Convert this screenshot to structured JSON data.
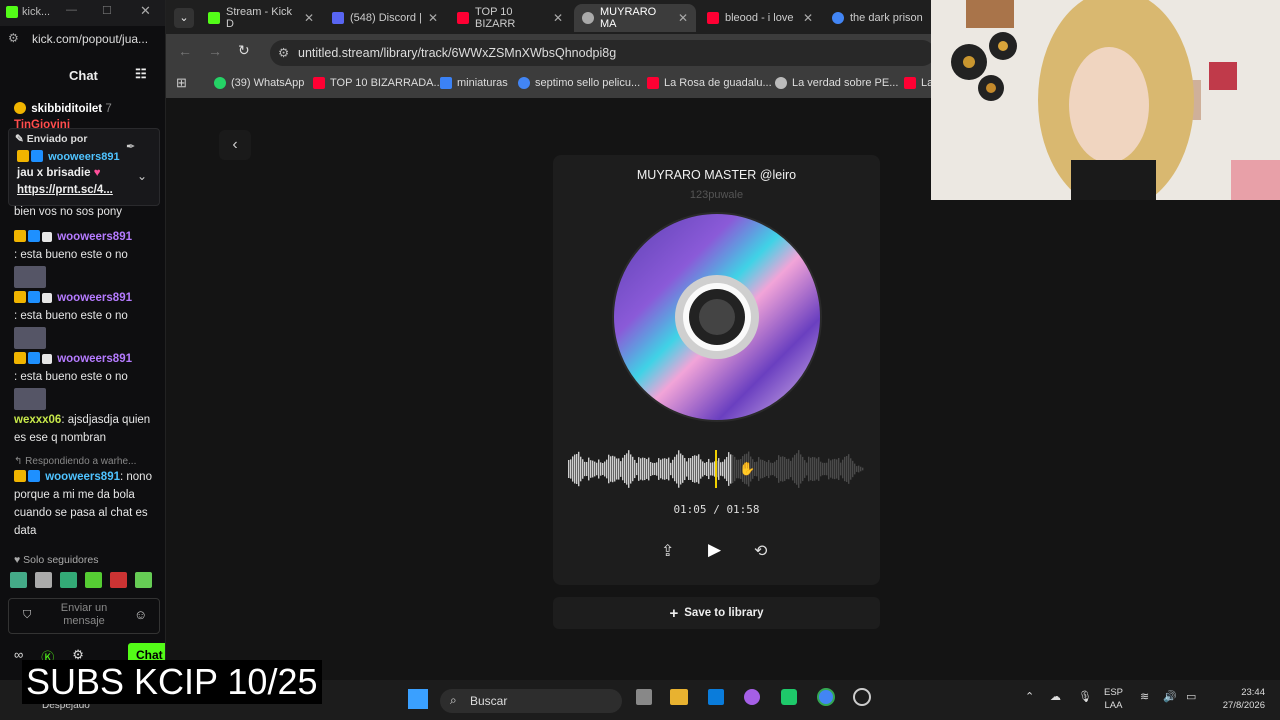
{
  "chat": {
    "window_title": "kick...",
    "url": "kick.com/popout/jua...",
    "header": "Chat",
    "top_user": "skibbiditoilet",
    "top_user_count": "7",
    "top_partial": "TinGiovini",
    "pinned_label": "Enviado por",
    "pinned_user": "wooweers891",
    "pinned_text": "jau x brisadie",
    "pinned_link": "https://prnt.sc/4...",
    "messages": [
      {
        "user": "",
        "text": "bien vos no sos pony"
      },
      {
        "user": "wooweers891",
        "text": ": esta bueno este o no"
      },
      {
        "user": "wooweers891",
        "text": ": esta bueno este o no"
      },
      {
        "user": "wooweers891",
        "text": ": esta bueno este o no"
      }
    ],
    "wexxx_user": "wexxx06",
    "wexxx_text": ": ajsdjasdja quien es ese q nombran",
    "reply_label": "Respondiendo a warhe...",
    "reply_user": "wooweers891",
    "reply_text": "nono porque a mi me da bola cuando se pasa al chat es data",
    "followers_only": "Solo seguidores",
    "input_placeholder": "Enviar un mensaje",
    "send_button": "Chat"
  },
  "browser": {
    "tabs": [
      {
        "label": "Stream - Kick D",
        "color": "#53fc18"
      },
      {
        "label": "(548) Discord |",
        "color": "#5865f2"
      },
      {
        "label": "TOP 10 BIZARR",
        "color": "#ff0033"
      },
      {
        "label": "MUYRARO MA",
        "color": "#aaaaaa"
      },
      {
        "label": "bleood - i love",
        "color": "#ff0033"
      },
      {
        "label": "the dark prison",
        "color": "#4285f4"
      }
    ],
    "url": "untitled.stream/library/track/6WWxZSMnXWbsQhnodpi8g",
    "bookmarks": [
      {
        "label": "(39) WhatsApp",
        "color": "#25d366"
      },
      {
        "label": "TOP 10 BIZARRADA...",
        "color": "#ff0033"
      },
      {
        "label": "miniaturas",
        "color": "#3b82f6"
      },
      {
        "label": "septimo sello pelicu...",
        "color": "#4285f4"
      },
      {
        "label": "La Rosa de guadalu...",
        "color": "#ff0033"
      },
      {
        "label": "La verdad sobre PE...",
        "color": "#bbbbbb"
      },
      {
        "label": "La",
        "color": "#ff0033"
      }
    ]
  },
  "player": {
    "title": "MUYRARO MASTER @leiro",
    "artist": "123puwale",
    "current_time": "01:05",
    "separator": "/",
    "duration": "01:58",
    "progress": 0.55,
    "save_label": "Save to library"
  },
  "taskbar": {
    "weather": "Despejado",
    "search_placeholder": "Buscar",
    "lang_top": "ESP",
    "lang_bottom": "LAA",
    "time": "23:44",
    "date": "27/8/2026"
  },
  "overlay": {
    "text": "SUBS KCIP 10/25"
  }
}
